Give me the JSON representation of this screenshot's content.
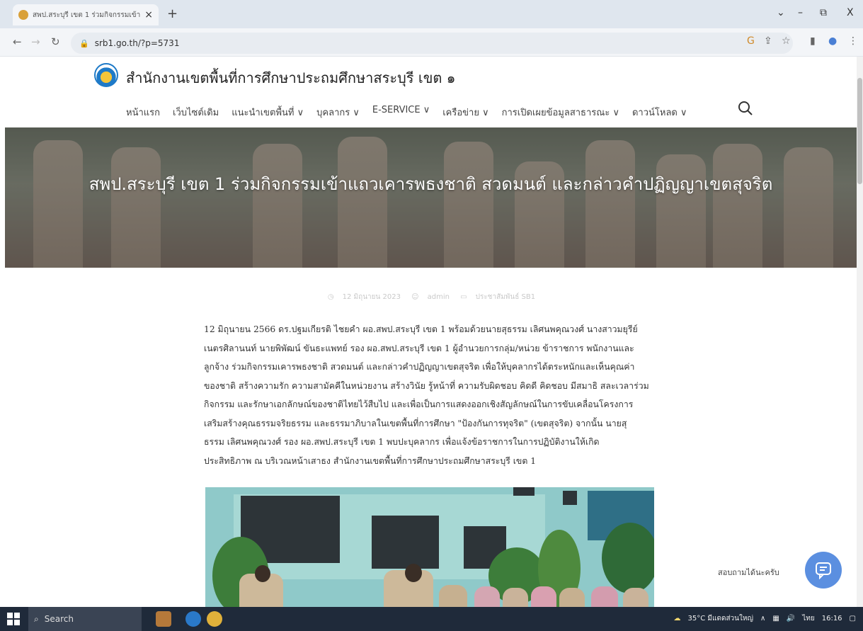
{
  "browser": {
    "tab_title": "สพป.สระบุรี เขต 1 ร่วมกิจกรรมเข้าแ",
    "tab_close": "×",
    "new_tab": "+",
    "url": "srb1.go.th/?p=5731",
    "window_minimize": "–",
    "window_restore": "⧉",
    "window_close": "X",
    "tab_list": "⌄"
  },
  "site": {
    "title": "สำนักงานเขตพื้นที่การศึกษาประถมศึกษาสระบุรี เขต ๑",
    "menu": [
      "หน้าแรก",
      "เว็บไซต์เดิม",
      "แนะนำเขตพื้นที่ ∨",
      "บุคลากร ∨",
      "E-SERVICE ∨",
      "เครือข่าย ∨",
      "การเปิดเผยข้อมูลสาธารณะ ∨",
      "ดาวน์โหลด ∨"
    ]
  },
  "post": {
    "title": "สพป.สระบุรี เขต 1 ร่วมกิจกรรมเข้าแถวเคารพธงชาติ สวดมนต์ และกล่าวคำปฏิญญาเขตสุจริต",
    "date": "12 มิถุนายน 2023",
    "author": "admin",
    "category": "ประชาสัมพันธ์ SB1",
    "body_lines": [
      "12 มิถุนายน 2566 ดร.ปฐมเกียรติ ไชยคำ ผอ.สพป.สระบุรี เขต 1 พร้อมด้วยนายสุธรรม เลิศนพคุณวงศ์ นางสาวมยุรีย์",
      "เนตรศิลานนท์ นายพิพัฒน์ ขันธะแพทย์ รอง ผอ.สพป.สระบุรี เขต 1 ผู้อำนวยการกลุ่ม/หน่วย ข้าราชการ พนักงานและ",
      "ลูกจ้าง ร่วมกิจกรรมเคารพธงชาติ สวดมนต์ และกล่าวคำปฏิญญาเขตสุจริต เพื่อให้บุคลากรได้ตระหนักและเห็นคุณค่า",
      "ของชาติ สร้างความรัก ความสามัคคีในหน่วยงาน สร้างวินัย รู้หน้าที่ ความรับผิดชอบ คิดดี คิดชอบ มีสมาธิ สละเวลาร่วม",
      "กิจกรรม และรักษาเอกลักษณ์ของชาติไทยไว้สืบไป และเพื่อเป็นการแสดงออกเชิงสัญลักษณ์ในการขับเคลื่อนโครงการ",
      "เสริมสร้างคุณธรรมจริยธรรม และธรรมาภิบาลในเขตพื้นที่การศึกษา \"ป้องกันการทุจริต\" (เขตสุจริต) จากนั้น นายสุ",
      "ธรรม เลิศนพคุณวงศ์ รอง ผอ.สพป.สระบุรี เขต 1 พบปะบุคลากร เพื่อแจ้งข้อราชการในการปฏิบัติงานให้เกิด",
      "ประสิทธิภาพ ณ บริเวณหน้าเสาธง สำนักงานเขตพื้นที่การศึกษาประถมศึกษาสระบุรี เขต 1"
    ]
  },
  "chat": {
    "label": "สอบถามได้นะครับ"
  },
  "taskbar": {
    "search": "Search",
    "weather": "35°C มีแดดส่วนใหญ่",
    "lang": "ไทย",
    "time": "16:16"
  },
  "colors": {
    "accent": "#5b8fe0",
    "taskbar": "#1f2a3a"
  }
}
